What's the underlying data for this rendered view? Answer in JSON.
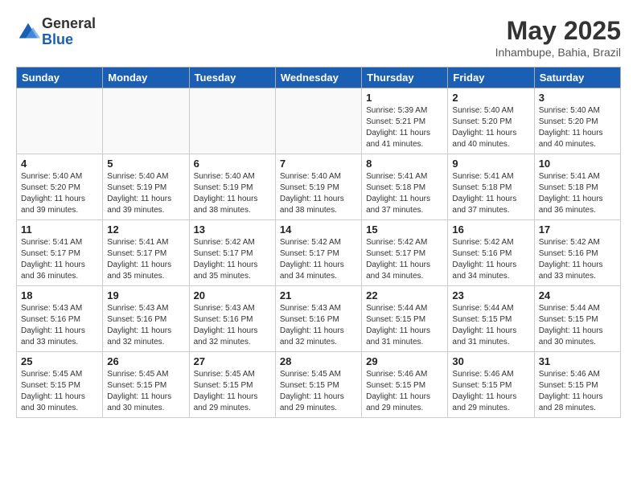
{
  "logo": {
    "general": "General",
    "blue": "Blue"
  },
  "title": "May 2025",
  "location": "Inhambupe, Bahia, Brazil",
  "days_of_week": [
    "Sunday",
    "Monday",
    "Tuesday",
    "Wednesday",
    "Thursday",
    "Friday",
    "Saturday"
  ],
  "weeks": [
    [
      {
        "day": "",
        "info": ""
      },
      {
        "day": "",
        "info": ""
      },
      {
        "day": "",
        "info": ""
      },
      {
        "day": "",
        "info": ""
      },
      {
        "day": "1",
        "info": "Sunrise: 5:39 AM\nSunset: 5:21 PM\nDaylight: 11 hours\nand 41 minutes."
      },
      {
        "day": "2",
        "info": "Sunrise: 5:40 AM\nSunset: 5:20 PM\nDaylight: 11 hours\nand 40 minutes."
      },
      {
        "day": "3",
        "info": "Sunrise: 5:40 AM\nSunset: 5:20 PM\nDaylight: 11 hours\nand 40 minutes."
      }
    ],
    [
      {
        "day": "4",
        "info": "Sunrise: 5:40 AM\nSunset: 5:20 PM\nDaylight: 11 hours\nand 39 minutes."
      },
      {
        "day": "5",
        "info": "Sunrise: 5:40 AM\nSunset: 5:19 PM\nDaylight: 11 hours\nand 39 minutes."
      },
      {
        "day": "6",
        "info": "Sunrise: 5:40 AM\nSunset: 5:19 PM\nDaylight: 11 hours\nand 38 minutes."
      },
      {
        "day": "7",
        "info": "Sunrise: 5:40 AM\nSunset: 5:19 PM\nDaylight: 11 hours\nand 38 minutes."
      },
      {
        "day": "8",
        "info": "Sunrise: 5:41 AM\nSunset: 5:18 PM\nDaylight: 11 hours\nand 37 minutes."
      },
      {
        "day": "9",
        "info": "Sunrise: 5:41 AM\nSunset: 5:18 PM\nDaylight: 11 hours\nand 37 minutes."
      },
      {
        "day": "10",
        "info": "Sunrise: 5:41 AM\nSunset: 5:18 PM\nDaylight: 11 hours\nand 36 minutes."
      }
    ],
    [
      {
        "day": "11",
        "info": "Sunrise: 5:41 AM\nSunset: 5:17 PM\nDaylight: 11 hours\nand 36 minutes."
      },
      {
        "day": "12",
        "info": "Sunrise: 5:41 AM\nSunset: 5:17 PM\nDaylight: 11 hours\nand 35 minutes."
      },
      {
        "day": "13",
        "info": "Sunrise: 5:42 AM\nSunset: 5:17 PM\nDaylight: 11 hours\nand 35 minutes."
      },
      {
        "day": "14",
        "info": "Sunrise: 5:42 AM\nSunset: 5:17 PM\nDaylight: 11 hours\nand 34 minutes."
      },
      {
        "day": "15",
        "info": "Sunrise: 5:42 AM\nSunset: 5:17 PM\nDaylight: 11 hours\nand 34 minutes."
      },
      {
        "day": "16",
        "info": "Sunrise: 5:42 AM\nSunset: 5:16 PM\nDaylight: 11 hours\nand 34 minutes."
      },
      {
        "day": "17",
        "info": "Sunrise: 5:42 AM\nSunset: 5:16 PM\nDaylight: 11 hours\nand 33 minutes."
      }
    ],
    [
      {
        "day": "18",
        "info": "Sunrise: 5:43 AM\nSunset: 5:16 PM\nDaylight: 11 hours\nand 33 minutes."
      },
      {
        "day": "19",
        "info": "Sunrise: 5:43 AM\nSunset: 5:16 PM\nDaylight: 11 hours\nand 32 minutes."
      },
      {
        "day": "20",
        "info": "Sunrise: 5:43 AM\nSunset: 5:16 PM\nDaylight: 11 hours\nand 32 minutes."
      },
      {
        "day": "21",
        "info": "Sunrise: 5:43 AM\nSunset: 5:16 PM\nDaylight: 11 hours\nand 32 minutes."
      },
      {
        "day": "22",
        "info": "Sunrise: 5:44 AM\nSunset: 5:15 PM\nDaylight: 11 hours\nand 31 minutes."
      },
      {
        "day": "23",
        "info": "Sunrise: 5:44 AM\nSunset: 5:15 PM\nDaylight: 11 hours\nand 31 minutes."
      },
      {
        "day": "24",
        "info": "Sunrise: 5:44 AM\nSunset: 5:15 PM\nDaylight: 11 hours\nand 30 minutes."
      }
    ],
    [
      {
        "day": "25",
        "info": "Sunrise: 5:45 AM\nSunset: 5:15 PM\nDaylight: 11 hours\nand 30 minutes."
      },
      {
        "day": "26",
        "info": "Sunrise: 5:45 AM\nSunset: 5:15 PM\nDaylight: 11 hours\nand 30 minutes."
      },
      {
        "day": "27",
        "info": "Sunrise: 5:45 AM\nSunset: 5:15 PM\nDaylight: 11 hours\nand 29 minutes."
      },
      {
        "day": "28",
        "info": "Sunrise: 5:45 AM\nSunset: 5:15 PM\nDaylight: 11 hours\nand 29 minutes."
      },
      {
        "day": "29",
        "info": "Sunrise: 5:46 AM\nSunset: 5:15 PM\nDaylight: 11 hours\nand 29 minutes."
      },
      {
        "day": "30",
        "info": "Sunrise: 5:46 AM\nSunset: 5:15 PM\nDaylight: 11 hours\nand 29 minutes."
      },
      {
        "day": "31",
        "info": "Sunrise: 5:46 AM\nSunset: 5:15 PM\nDaylight: 11 hours\nand 28 minutes."
      }
    ]
  ]
}
